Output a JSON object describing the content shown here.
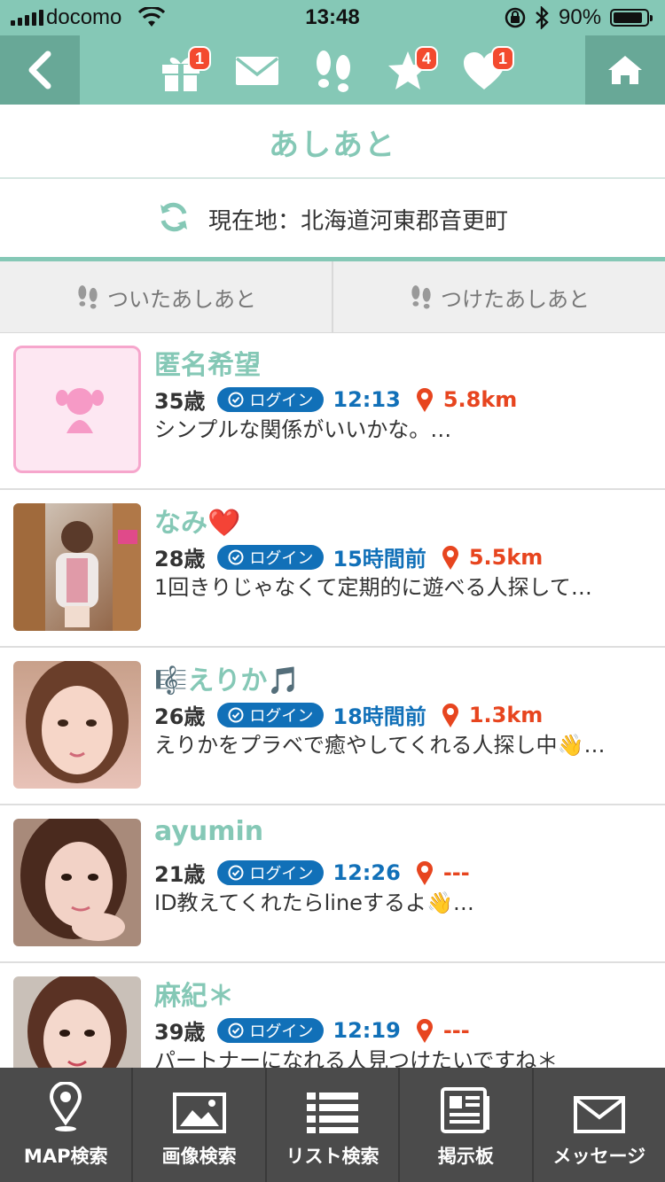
{
  "status_bar": {
    "carrier": "docomo",
    "time": "13:48",
    "battery_percent_label": "90%",
    "battery_level": 0.9
  },
  "nav": {
    "badges": {
      "gift": "1",
      "star": "4",
      "heart": "1"
    }
  },
  "page_title": "あしあと",
  "location": "現在地：北海道河東郡音更町",
  "tabs": [
    {
      "label": "ついたあしあと"
    },
    {
      "label": "つけたあしあと"
    }
  ],
  "login_label": "ログイン",
  "users": [
    {
      "name": "匿名希望",
      "age": "35歳",
      "time": "12:13",
      "distance": "5.8km",
      "message": "シンプルな関係がいいかな。…"
    },
    {
      "name": "なみ❤️",
      "age": "28歳",
      "time": "15時間前",
      "distance": "5.5km",
      "message": "1回きりじゃなくて定期的に遊べる人探して…"
    },
    {
      "name": "🎼えりか🎵",
      "age": "26歳",
      "time": "18時間前",
      "distance": "1.3km",
      "message": "えりかをプラベで癒やしてくれる人探し中👋…"
    },
    {
      "name": "ayumin",
      "age": "21歳",
      "time": "12:26",
      "distance": "---",
      "message": "ID教えてくれたらlineするよ👋…"
    },
    {
      "name": "麻紀＊",
      "age": "39歳",
      "time": "12:19",
      "distance": "---",
      "message": "パートナーになれる人見つけたいですね＊"
    }
  ],
  "tabbar": [
    {
      "label": "MAP検索",
      "icon": "map-pin-icon"
    },
    {
      "label": "画像検索",
      "icon": "image-icon"
    },
    {
      "label": "リスト検索",
      "icon": "list-icon"
    },
    {
      "label": "掲示板",
      "icon": "board-icon"
    },
    {
      "label": "メッセージ",
      "icon": "envelope-icon"
    }
  ],
  "colors": {
    "theme": "#85c8b6",
    "theme_dark": "#68a897",
    "login_blue": "#1170b8",
    "distance_red": "#e7451f",
    "badge_red": "#f34a2f",
    "tabbar_bg": "#4b4b4b"
  }
}
